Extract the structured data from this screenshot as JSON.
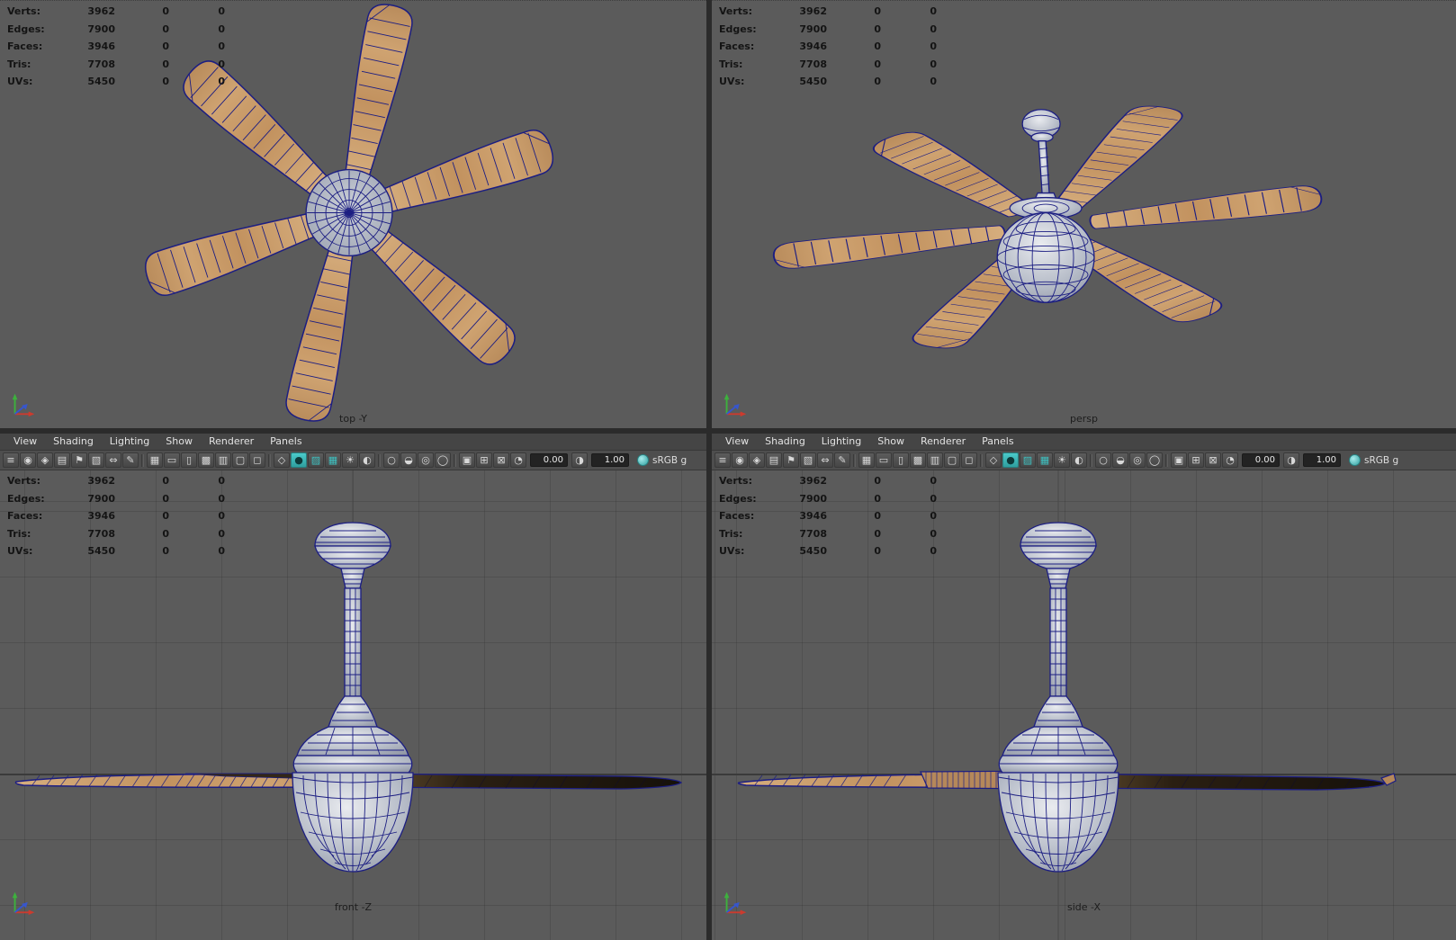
{
  "colors": {
    "bg": "#5b5b5b",
    "wire": "#1c1e82",
    "accent": "#3ec1c1",
    "hud": "#141414",
    "wood": "#c49a6b",
    "grid": "#4c4c4c",
    "panel": "#4a4a4a"
  },
  "stats": {
    "rows": [
      {
        "label": "Verts:",
        "value": "3962",
        "c1": "0",
        "c2": "0"
      },
      {
        "label": "Edges:",
        "value": "7900",
        "c1": "0",
        "c2": "0"
      },
      {
        "label": "Faces:",
        "value": "3946",
        "c1": "0",
        "c2": "0"
      },
      {
        "label": "Tris:",
        "value": "7708",
        "c1": "0",
        "c2": "0"
      },
      {
        "label": "UVs:",
        "value": "5450",
        "c1": "0",
        "c2": "0"
      }
    ]
  },
  "viewports": {
    "top": {
      "label": "top -Y"
    },
    "persp": {
      "label": "persp"
    },
    "front": {
      "label": "front -Z"
    },
    "side": {
      "label": "side -X"
    }
  },
  "menu": {
    "items": [
      "View",
      "Shading",
      "Lighting",
      "Show",
      "Renderer",
      "Panels"
    ]
  },
  "toolbar": {
    "exposure_icon": "◔",
    "gamma_icon": "◑",
    "fields": {
      "exposure": "0.00",
      "gamma": "1.00",
      "colorspace": "sRGB g"
    },
    "icons": [
      {
        "name": "menu-collapse-icon",
        "glyph": "≡"
      },
      {
        "name": "camera-select-icon",
        "glyph": "◉"
      },
      {
        "name": "camera-lock-icon",
        "glyph": "◈"
      },
      {
        "name": "camera-attrs-icon",
        "glyph": "▤"
      },
      {
        "name": "bookmark-icon",
        "glyph": "⚑"
      },
      {
        "name": "image-plane-icon",
        "glyph": "▧"
      },
      {
        "name": "pan-zoom-icon",
        "glyph": "⇔"
      },
      {
        "name": "grease-pencil-icon",
        "glyph": "✎"
      },
      {
        "name": "separator",
        "glyph": "",
        "cls": "sep"
      },
      {
        "name": "grid-icon",
        "glyph": "▦"
      },
      {
        "name": "film-gate-icon",
        "glyph": "▭"
      },
      {
        "name": "resolution-gate-icon",
        "glyph": "▯"
      },
      {
        "name": "gate-mask-icon",
        "glyph": "▩"
      },
      {
        "name": "field-chart-icon",
        "glyph": "▥"
      },
      {
        "name": "safe-action-icon",
        "glyph": "▢"
      },
      {
        "name": "safe-title-icon",
        "glyph": "◻"
      },
      {
        "name": "separator",
        "glyph": "",
        "cls": "sep"
      },
      {
        "name": "wireframe-icon",
        "glyph": "◇"
      },
      {
        "name": "smooth-shade-icon",
        "glyph": "●",
        "cls": "teal-bg"
      },
      {
        "name": "textured-icon",
        "glyph": "▨",
        "cls": "teal"
      },
      {
        "name": "checkered-icon",
        "glyph": "▦",
        "cls": "teal"
      },
      {
        "name": "use-lights-icon",
        "glyph": "☀"
      },
      {
        "name": "shadows-icon",
        "glyph": "◐"
      },
      {
        "name": "separator",
        "glyph": "",
        "cls": "sep"
      },
      {
        "name": "default-material-icon",
        "glyph": "○"
      },
      {
        "name": "xray-icon",
        "glyph": "◒"
      },
      {
        "name": "occlusion-icon",
        "glyph": "◎"
      },
      {
        "name": "anti-alias-icon",
        "glyph": "◯"
      },
      {
        "name": "separator",
        "glyph": "",
        "cls": "sep"
      },
      {
        "name": "isolate-select-icon",
        "glyph": "▣"
      },
      {
        "name": "split-view-icon",
        "glyph": "⊞"
      },
      {
        "name": "snap-icon",
        "glyph": "⊠"
      }
    ]
  }
}
